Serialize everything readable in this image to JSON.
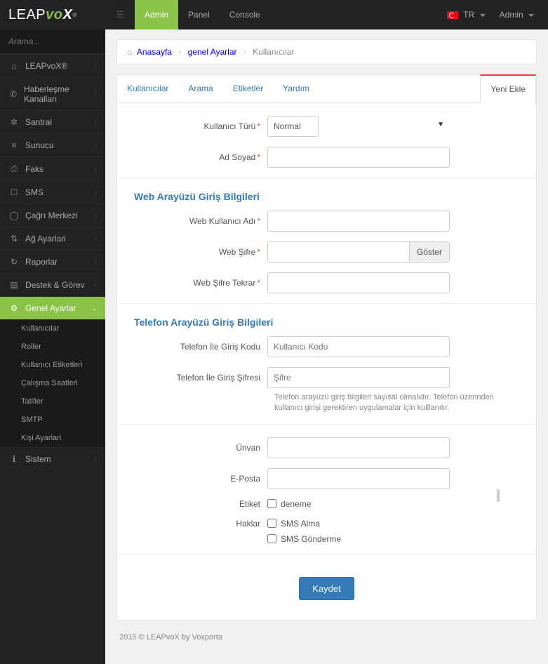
{
  "brand": {
    "p1": "LEAP",
    "p2": "vo",
    "p3": "X",
    "sup": "®"
  },
  "topnav": {
    "admin": "Admin",
    "panel": "Panel",
    "console": "Console"
  },
  "topright": {
    "lang": "TR",
    "user": "Admin"
  },
  "search_placeholder": "Arama...",
  "sidebar": {
    "items": [
      {
        "icon": "⌂",
        "label": "LEAPvoX®"
      },
      {
        "icon": "✆",
        "label": "Haberleşme Kanalları"
      },
      {
        "icon": "✲",
        "label": "Santral"
      },
      {
        "icon": "≡",
        "label": "Sunucu"
      },
      {
        "icon": "⎙",
        "label": "Faks"
      },
      {
        "icon": "☐",
        "label": "SMS"
      },
      {
        "icon": "◯",
        "label": "Çağrı Merkezi"
      },
      {
        "icon": "⇅",
        "label": "Ağ Ayarlari"
      },
      {
        "icon": "↻",
        "label": "Raporlar"
      },
      {
        "icon": "▤",
        "label": "Destek & Görev"
      }
    ],
    "open": {
      "icon": "⚙",
      "label": "Genel Ayarlar"
    },
    "sub": [
      "Kullanıcılar",
      "Roller",
      "Kullanıcı Etiketleri",
      "Çalışma Saatleri",
      "Tatiller",
      "SMTP",
      "Kişi Ayarlari"
    ],
    "last": {
      "icon": "ℹ",
      "label": "Sistem"
    }
  },
  "breadcrumb": {
    "home": "Anasayfa",
    "b1": "genel Ayarlar",
    "b2": "Kullanıcılar"
  },
  "tabs": {
    "t1": "Kullanıcılar",
    "t2": "Arama",
    "t3": "Etiketler",
    "t4": "Yardım",
    "active": "Yeni Ekle"
  },
  "form": {
    "user_type_label": "Kullanıcı Türü",
    "user_type_value": "Normal",
    "fullname_label": "Ad Soyad",
    "section_web": "Web Arayüzü Giriş Bilgileri",
    "web_user_label": "Web Kullanıcı Adı",
    "web_pass_label": "Web Şifre",
    "show_btn": "Göster",
    "web_pass2_label": "Web Şifre Tekrar",
    "section_phone": "Telefon Arayüzü Giriş Bilgileri",
    "phone_code_label": "Telefon İle Giriş Kodu",
    "phone_code_placeholder": "Kullanıcı Kodu",
    "phone_pass_label": "Telefon İle Giriş Şifresi",
    "phone_pass_placeholder": "Şifre",
    "phone_help": "Telefon arayüzü giriş bilgileri sayısal olmalıdır. Telefon üzerinden kullanıcı girişi gerektiren uygulamalar için kulllanılır.",
    "title_label": "Ünvan",
    "email_label": "E-Posta",
    "tag_label": "Etiket",
    "tag_option": "deneme",
    "rights_label": "Haklar",
    "right1": "SMS Alma",
    "right2": "SMS Gönderme",
    "save": "Kaydet"
  },
  "footer": "2015 © LEAPvoX by Voxporta"
}
